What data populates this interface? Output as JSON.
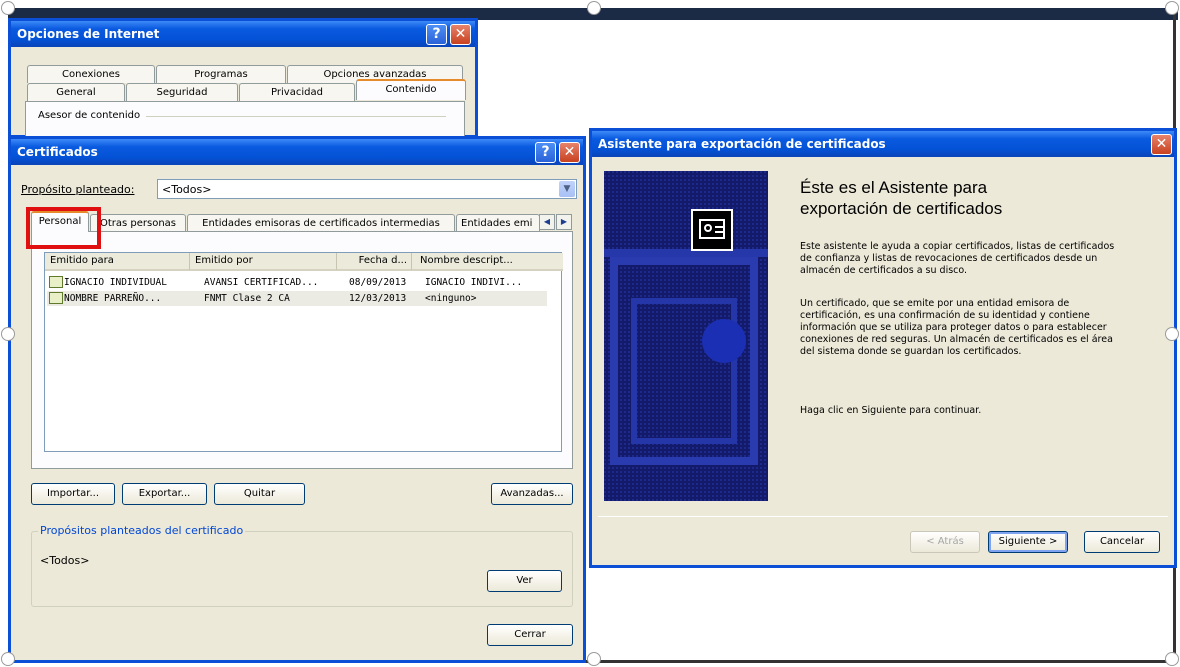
{
  "internet_options": {
    "title": "Opciones de Internet",
    "tabs_row1": [
      "Conexiones",
      "Programas",
      "Opciones avanzadas"
    ],
    "tabs_row2": [
      "General",
      "Seguridad",
      "Privacidad",
      "Contenido"
    ],
    "group_label": "Asesor de contenido"
  },
  "certificados": {
    "title": "Certificados",
    "purpose_label": "Propósito planteado:",
    "purpose_value": "<Todos>",
    "tabs": [
      "Personal",
      "Otras personas",
      "Entidades emisoras de certificados intermedias",
      "Entidades emi"
    ],
    "columns": [
      "Emitido para",
      "Emitido por",
      "Fecha d...",
      "Nombre descript..."
    ],
    "rows": [
      [
        "IGNACIO INDIVIDUAL",
        "AVANSI CERTIFICAD...",
        "08/09/2013",
        "IGNACIO INDIVI..."
      ],
      [
        "NOMBRE PARREÑO...",
        "FNMT Clase 2 CA",
        "12/03/2013",
        "<ninguno>"
      ]
    ],
    "buttons": {
      "importar": "Importar...",
      "exportar": "Exportar...",
      "quitar": "Quitar",
      "avanzadas": "Avanzadas...",
      "ver": "Ver",
      "cerrar": "Cerrar"
    },
    "purposes_group_label": "Propósitos planteados del certificado",
    "purposes_value": "<Todos>"
  },
  "wizard": {
    "title": "Asistente para exportación de certificados",
    "heading": "Éste es el Asistente para exportación de certificados",
    "paragraph1": "Este asistente le ayuda a copiar certificados, listas de certificados de confianza y listas de revocaciones de certificados desde un almacén de certificados a su disco.",
    "paragraph2": "Un certificado, que se emite por una entidad emisora de certificación, es una confirmación de su identidad y contiene información que se utiliza para proteger datos o para establecer conexiones de red seguras. Un almacén de certificados es el área del sistema donde se guardan los certificados.",
    "paragraph3": "Haga clic en Siguiente para continuar.",
    "buttons": {
      "atras": "< Atrás",
      "siguiente": "Siguiente >",
      "cancelar": "Cancelar"
    }
  },
  "colors": {
    "xp_blue": "#0b4fd6",
    "dialog_bg": "#ece9d8",
    "highlight_box": "#e01010",
    "wizard_panel": "#131a6a"
  }
}
